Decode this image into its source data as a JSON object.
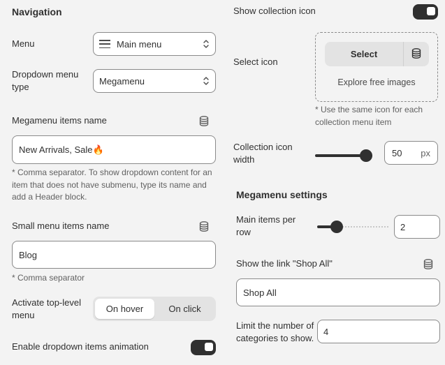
{
  "left": {
    "section_title": "Navigation",
    "menu": {
      "label": "Menu",
      "value": "Main menu"
    },
    "dropdown_type": {
      "label": "Dropdown menu type",
      "value": "Megamenu"
    },
    "megamenu_items": {
      "label": "Megamenu items name",
      "value": "New Arrivals, Sale🔥",
      "help": "* Comma separator. To show dropdown content for an item that does not have submenu, type its name and add a Header block."
    },
    "small_menu_items": {
      "label": "Small menu items name",
      "value": "Blog",
      "help": "* Comma separator"
    },
    "activate": {
      "label": "Activate top-level menu",
      "options": [
        "On hover",
        "On click"
      ],
      "selected": "On hover"
    },
    "animation": {
      "label": "Enable dropdown items animation",
      "enabled": true
    }
  },
  "right": {
    "show_icon": {
      "label": "Show collection icon",
      "enabled": true
    },
    "select_icon": {
      "label": "Select icon",
      "button": "Select",
      "explore": "Explore free images",
      "help": "* Use the same icon for each collection menu item"
    },
    "icon_width": {
      "label": "Collection icon width",
      "value": "50",
      "unit": "px",
      "slider_fraction": 1.0
    },
    "megamenu_settings": {
      "title": "Megamenu settings",
      "items_per_row": {
        "label": "Main items per row",
        "value": "2",
        "slider_fraction": 0.23
      },
      "shop_all": {
        "label": "Show the link \"Shop All\"",
        "value": "Shop All"
      },
      "limit": {
        "label": "Limit the number of categories to show.",
        "value": "4"
      }
    }
  },
  "icons": {
    "menu": "hamburger-icon",
    "chevron": "chevron-updown-icon",
    "dynamic_source": "database-icon"
  },
  "colors": {
    "toggle_on": "#303030",
    "text": "#303030",
    "muted": "#616161",
    "background": "#f3f3f3"
  }
}
